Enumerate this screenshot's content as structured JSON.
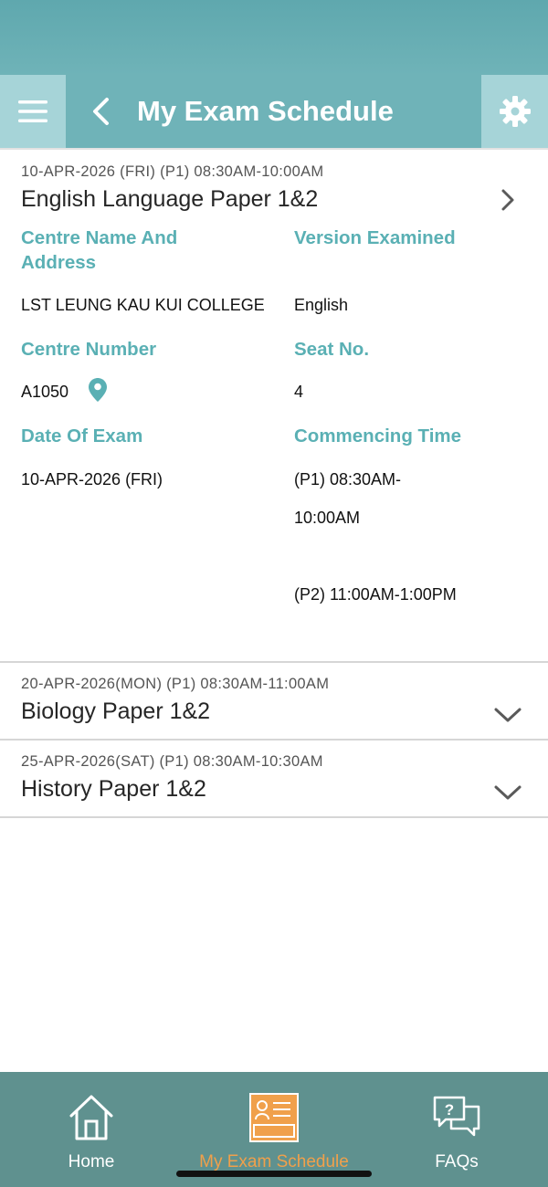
{
  "header": {
    "title": "My Exam Schedule",
    "menu_icon": "menu-icon",
    "back_icon": "chevron-left-icon",
    "settings_icon": "gear-icon"
  },
  "exams": [
    {
      "date_line": "10-APR-2026 (FRI)  (P1) 08:30AM-10:00AM",
      "title": "English Language Paper 1&2",
      "expanded": true,
      "details": {
        "centre_name_label": "Centre Name And\nAddress",
        "centre_name_value": "LST LEUNG KAU KUI COLLEGE",
        "version_label": "Version Examined",
        "version_value": "English",
        "centre_number_label": "Centre Number",
        "centre_number_value": "A1050",
        "seat_label": "Seat No.",
        "seat_value": "4",
        "date_label": "Date Of Exam",
        "date_value": "10-APR-2026 (FRI)",
        "time_label": "Commencing Time",
        "time_p1_line1": "(P1) 08:30AM-",
        "time_p1_line2": "10:00AM",
        "time_p2": "(P2) 11:00AM-1:00PM"
      }
    },
    {
      "date_line": "20-APR-2026(MON)  (P1) 08:30AM-11:00AM",
      "title": "Biology Paper 1&2",
      "expanded": false
    },
    {
      "date_line": "25-APR-2026(SAT)  (P1) 08:30AM-10:30AM",
      "title": "History Paper 1&2",
      "expanded": false
    }
  ],
  "tabbar": {
    "tabs": [
      {
        "label": "Home",
        "icon": "home-icon",
        "active": false
      },
      {
        "label": "My Exam Schedule",
        "icon": "exam-schedule-icon",
        "active": true
      },
      {
        "label": "FAQs",
        "icon": "faq-chat-icon",
        "active": false
      }
    ]
  },
  "colors": {
    "header_bg": "#6fb3b8",
    "header_button_bg": "#a6d4d8",
    "label_teal": "#5ab0b4",
    "tabbar_bg": "#5f918f",
    "active_tab": "#f0a04b"
  }
}
